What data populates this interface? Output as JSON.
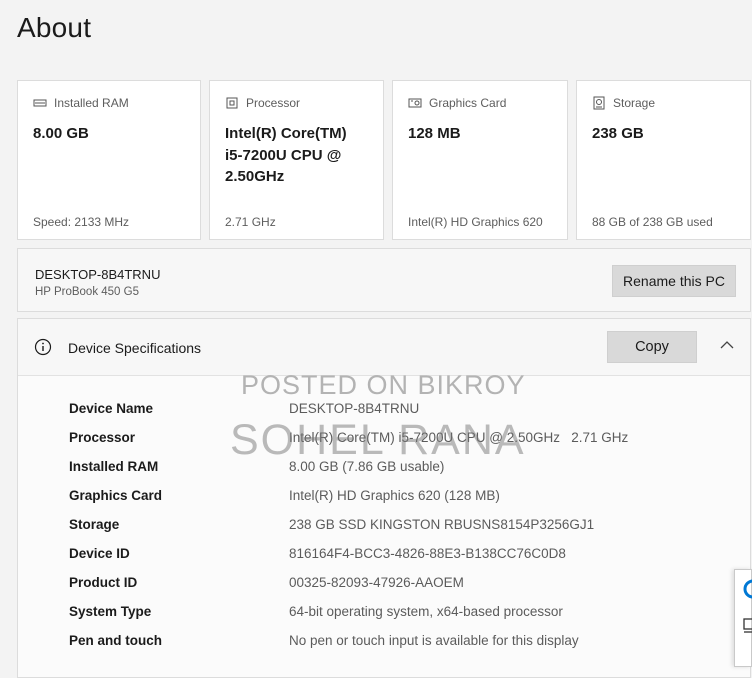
{
  "page": {
    "title": "About"
  },
  "cards": [
    {
      "icon": "ram-icon",
      "label": "Installed RAM",
      "value_lines": [
        "8.00 GB"
      ],
      "footer": "Speed: 2133 MHz"
    },
    {
      "icon": "processor-icon",
      "label": "Processor",
      "value_lines": [
        "Intel(R) Core(TM)",
        "i5-7200U CPU @",
        "2.50GHz"
      ],
      "footer": "2.71 GHz"
    },
    {
      "icon": "graphics-card-icon",
      "label": "Graphics Card",
      "value_lines": [
        "128 MB"
      ],
      "footer": "Intel(R) HD Graphics 620"
    },
    {
      "icon": "storage-icon",
      "label": "Storage",
      "value_lines": [
        "238 GB"
      ],
      "footer": "88 GB of 238 GB used"
    }
  ],
  "pc": {
    "name": "DESKTOP-8B4TRNU",
    "model": "HP ProBook 450 G5",
    "rename_label": "Rename this PC"
  },
  "specs": {
    "title": "Device Specifications",
    "copy_label": "Copy",
    "rows": [
      {
        "label": "Device Name",
        "value": "DESKTOP-8B4TRNU"
      },
      {
        "label": "Processor",
        "value": "Intel(R) Core(TM) i5-7200U CPU @ 2.50GHz   2.71 GHz"
      },
      {
        "label": "Installed RAM",
        "value": "8.00 GB (7.86 GB usable)"
      },
      {
        "label": "Graphics Card",
        "value": "Intel(R) HD Graphics 620 (128 MB)"
      },
      {
        "label": "Storage",
        "value": "238 GB SSD KINGSTON RBUSNS8154P3256GJ1"
      },
      {
        "label": "Device ID",
        "value": "816164F4-BCC3-4826-88E3-B138CC76C0D8"
      },
      {
        "label": "Product ID",
        "value": "00325-82093-47926-AAOEM"
      },
      {
        "label": "System Type",
        "value": "64-bit operating system, x64-based processor"
      },
      {
        "label": "Pen and touch",
        "value": "No pen or touch input is available for this display"
      }
    ]
  },
  "watermark": {
    "line1": "POSTED ON BIKROY",
    "line2": "SOHEL RANA"
  },
  "colors": {
    "edge_accent": "#0078d4",
    "button_bg": "#d9d9d9"
  }
}
